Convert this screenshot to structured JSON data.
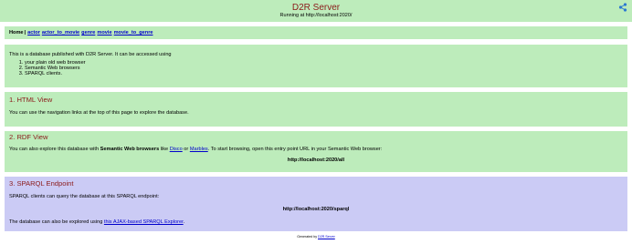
{
  "header": {
    "title": "D2R Server",
    "subtitle": "Running at http://localhost:2020/"
  },
  "nav": {
    "home": "Home",
    "separator": "|",
    "links": [
      "actor",
      "actor_to_movie",
      "genre",
      "movie",
      "movie_to_genre"
    ]
  },
  "intro": {
    "text": "This is a database published with D2R Server. It can be accessed using",
    "items": [
      "your plain old web browser",
      "Semantic Web browsers",
      "SPARQL clients."
    ]
  },
  "html_view": {
    "heading": "1. HTML View",
    "text": "You can use the navigation links at the top of this page to explore the database."
  },
  "rdf_view": {
    "heading": "2. RDF View",
    "text_before": "You can also explore this database with",
    "bold": "Semantic Web browsers",
    "text_like": "like",
    "link_disco": "Disco",
    "text_or": "or",
    "link_marbles": "Marbles",
    "text_after": ". To start browsing, open this entry point URL in your Semantic Web browser:",
    "entry_url": "http://localhost:2020/all"
  },
  "sparql": {
    "heading": "3. SPARQL Endpoint",
    "text": "SPARQL clients can query the database at this SPARQL endpoint:",
    "endpoint_url": "http://localhost:2020/sparql",
    "explorer_before": "The database can also be explored using",
    "explorer_link": "this AJAX-based SPARQL Explorer",
    "explorer_after": "."
  },
  "footer": {
    "prefix": "Generated by",
    "link": "D2R Server"
  },
  "colors": {
    "green_panel": "#bdecbb",
    "blue_panel": "#cbcbf5",
    "heading_red": "#8b1a1a",
    "link_blue": "#0000cc",
    "logo_blue": "#2b78d1"
  },
  "icons": {
    "rdf_logo": "rdf-graph-icon"
  }
}
